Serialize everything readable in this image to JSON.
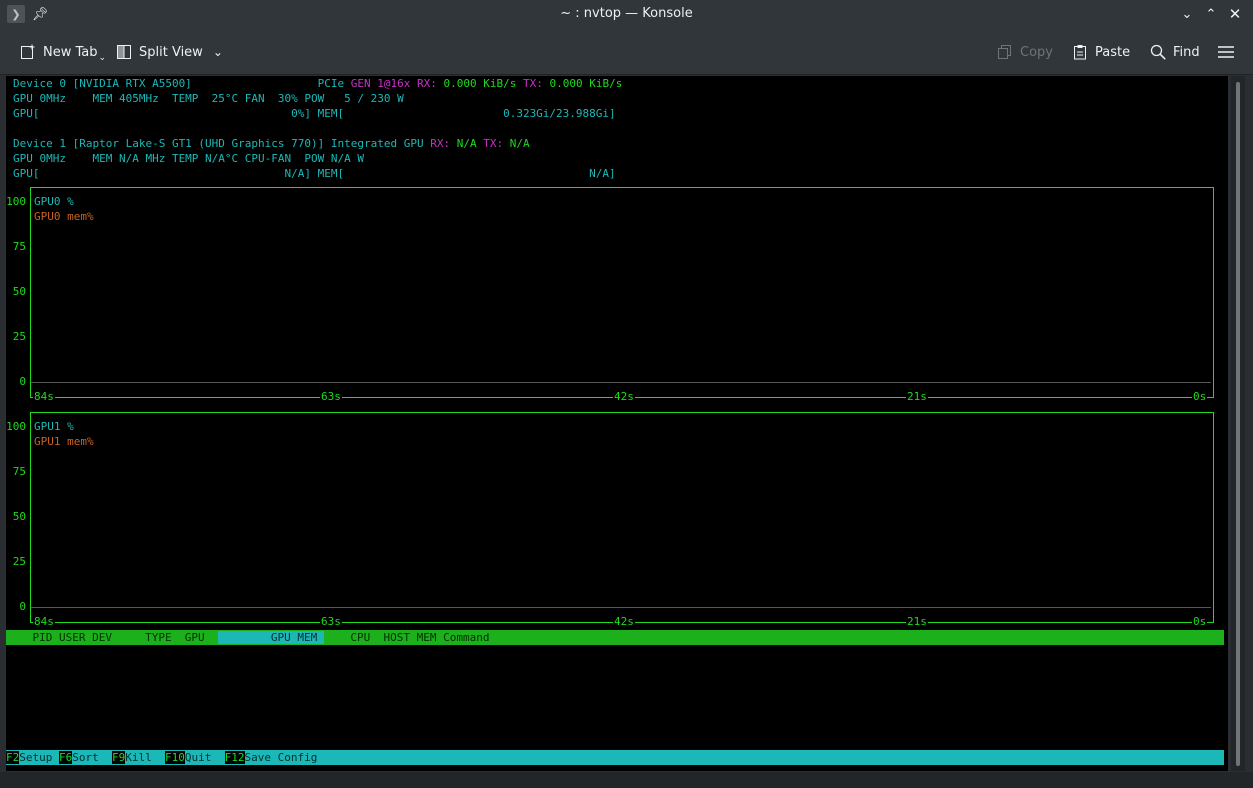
{
  "window": {
    "title": "~ : nvtop — Konsole"
  },
  "toolbar": {
    "new_tab": "New Tab",
    "split_view": "Split View",
    "copy": "Copy",
    "paste": "Paste",
    "find": "Find"
  },
  "device0": {
    "line1_name": "Device 0 [NVIDIA RTX A5500]",
    "line1_pcie": "PCIe",
    "line1_gen": "GEN 1@16x",
    "line1_rx_label": "RX:",
    "line1_rx": "0.000 KiB/s",
    "line1_tx_label": "TX:",
    "line1_tx": "0.000 KiB/s",
    "line2": "GPU 0MHz    MEM 405MHz  TEMP  25°C FAN  30% POW   5 / 230 W",
    "gpu_bar": "GPU[                                      0%]",
    "mem_bar": "MEM[                        0.323Gi/23.988Gi]"
  },
  "device1": {
    "line1_name": "Device 1 [Raptor Lake-S GT1 (UHD Graphics 770)] Integrated GPU",
    "line1_rx_label": "RX:",
    "line1_rx": "N/A",
    "line1_tx_label": "TX:",
    "line1_tx": "N/A",
    "line2": "GPU 0MHz    MEM N/A MHz TEMP N/A°C CPU-FAN  POW N/A W",
    "gpu_bar": "GPU[                                     N/A]",
    "mem_bar": "MEM[                                     N/A]"
  },
  "charts": [
    {
      "legend_gpu": "GPU0 %",
      "legend_mem": "GPU0 mem%",
      "y_ticks": [
        "100",
        "75",
        "50",
        "25",
        "0"
      ],
      "x_ticks": [
        "84s",
        "63s",
        "42s",
        "21s",
        "0s"
      ]
    },
    {
      "legend_gpu": "GPU1 %",
      "legend_mem": "GPU1 mem%",
      "y_ticks": [
        "100",
        "75",
        "50",
        "25",
        "0"
      ],
      "x_ticks": [
        "84s",
        "63s",
        "42s",
        "21s",
        "0s"
      ]
    }
  ],
  "process_header": {
    "before": "    PID USER DEV     TYPE  GPU  ",
    "selected": "        GPU MEM ",
    "after": "    CPU  HOST MEM Command"
  },
  "function_keys": [
    {
      "key": "F2",
      "label": "Setup "
    },
    {
      "key": "F6",
      "label": "Sort  "
    },
    {
      "key": "F9",
      "label": "Kill  "
    },
    {
      "key": "F10",
      "label": "Quit  "
    },
    {
      "key": "F12",
      "label": "Save Config"
    }
  ],
  "colors": {
    "term_green": "#1cdc1c",
    "term_cyan": "#1cb8b8",
    "term_magenta": "#c830c8",
    "term_orange": "#c86420"
  }
}
